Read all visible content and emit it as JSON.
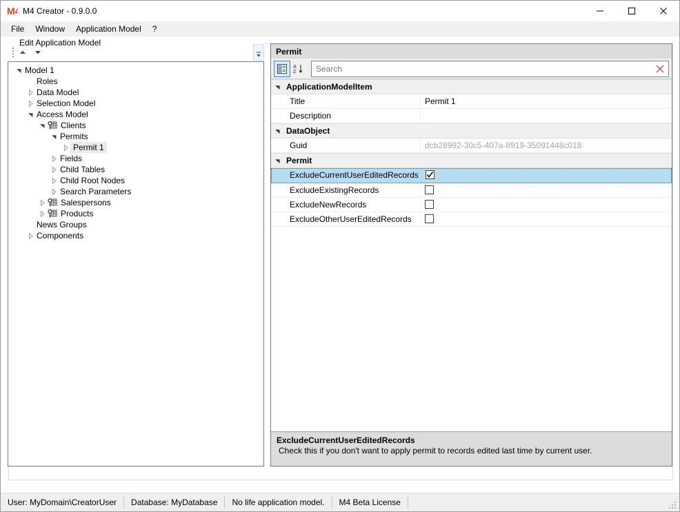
{
  "window": {
    "logo_icon": "m4-logo-icon",
    "title": "M4 Creator - 0.9.0.0",
    "controls": {
      "minimize": "minimize-icon",
      "maximize": "maximize-icon",
      "close": "close-icon"
    }
  },
  "menubar": {
    "items": [
      {
        "label": "File"
      },
      {
        "label": "Window"
      },
      {
        "label": "Application Model"
      },
      {
        "label": "?"
      }
    ]
  },
  "groupbox": {
    "label": "Edit Application Model"
  },
  "tree_toolbar": {
    "grip": "drag-grip-icon",
    "move_up": "move-up-icon",
    "move_down": "move-down-icon",
    "overflow": "toolbar-overflow-icon"
  },
  "tree": {
    "nodes": [
      {
        "label": "Model 1",
        "indent": 0,
        "twisty": "expanded",
        "icon": "",
        "selected": false
      },
      {
        "label": "Roles",
        "indent": 1,
        "twisty": "none",
        "icon": "",
        "selected": false
      },
      {
        "label": "Data Model",
        "indent": 1,
        "twisty": "collapsed",
        "icon": "",
        "selected": false
      },
      {
        "label": "Selection Model",
        "indent": 1,
        "twisty": "collapsed",
        "icon": "",
        "selected": false
      },
      {
        "label": "Access Model",
        "indent": 1,
        "twisty": "expanded",
        "icon": "",
        "selected": false
      },
      {
        "label": "Clients",
        "indent": 2,
        "twisty": "expanded",
        "icon": "table-key-icon",
        "selected": false
      },
      {
        "label": "Permits",
        "indent": 3,
        "twisty": "expanded",
        "icon": "",
        "selected": false
      },
      {
        "label": "Permit 1",
        "indent": 4,
        "twisty": "collapsed",
        "icon": "",
        "selected": true
      },
      {
        "label": "Fields",
        "indent": 3,
        "twisty": "collapsed",
        "icon": "",
        "selected": false
      },
      {
        "label": "Child Tables",
        "indent": 3,
        "twisty": "collapsed",
        "icon": "",
        "selected": false
      },
      {
        "label": "Child Root Nodes",
        "indent": 3,
        "twisty": "collapsed",
        "icon": "",
        "selected": false
      },
      {
        "label": "Search Parameters",
        "indent": 3,
        "twisty": "collapsed",
        "icon": "",
        "selected": false
      },
      {
        "label": "Salespersons",
        "indent": 2,
        "twisty": "collapsed",
        "icon": "table-key-icon",
        "selected": false
      },
      {
        "label": "Products",
        "indent": 2,
        "twisty": "collapsed",
        "icon": "table-key-icon",
        "selected": false
      },
      {
        "label": "News Groups",
        "indent": 1,
        "twisty": "none",
        "icon": "",
        "selected": false
      },
      {
        "label": "Components",
        "indent": 1,
        "twisty": "collapsed",
        "icon": "",
        "selected": false
      }
    ]
  },
  "property_grid": {
    "header": "Permit",
    "toolbar": {
      "categorized_icon": "categorized-view-icon",
      "alphabetical_icon": "alphabetical-sort-icon",
      "clear_icon": "clear-search-icon"
    },
    "search": {
      "value": "",
      "placeholder": "Search"
    },
    "rows": [
      {
        "kind": "group",
        "name": "ApplicationModelItem"
      },
      {
        "kind": "text",
        "name": "Title",
        "value": "Permit 1",
        "muted": false
      },
      {
        "kind": "text",
        "name": "Description",
        "value": "",
        "muted": false
      },
      {
        "kind": "group",
        "name": "DataObject"
      },
      {
        "kind": "text",
        "name": "Guid",
        "value": "dcb28992-30c5-407a-8919-35091448c018",
        "muted": true
      },
      {
        "kind": "group",
        "name": "Permit"
      },
      {
        "kind": "check",
        "name": "ExcludeCurrentUserEditedRecords",
        "checked": true,
        "selected": true
      },
      {
        "kind": "check",
        "name": "ExcludeExistingRecords",
        "checked": false,
        "selected": false
      },
      {
        "kind": "check",
        "name": "ExcludeNewRecords",
        "checked": false,
        "selected": false
      },
      {
        "kind": "check",
        "name": "ExcludeOtherUserEditedRecords",
        "checked": false,
        "selected": false
      }
    ],
    "description": {
      "title": "ExcludeCurrentUserEditedRecords",
      "text": "Check this if you don't want to apply permit to records edited last time by current user."
    }
  },
  "statusbar": {
    "cells": [
      {
        "label": "User: MyDomain\\CreatorUser"
      },
      {
        "label": "Database: MyDatabase"
      },
      {
        "label": "No life application model."
      },
      {
        "label": "M4 Beta License"
      }
    ],
    "grip": "resize-grip-icon"
  },
  "colors": {
    "accent_blue": "#4a7ebb",
    "selection_blue": "#b5dcf0",
    "logo_orange": "#e8401a",
    "clear_red": "#d06a6a",
    "group_gray": "#f0f0f0",
    "header_gray": "#dcdcdc"
  }
}
